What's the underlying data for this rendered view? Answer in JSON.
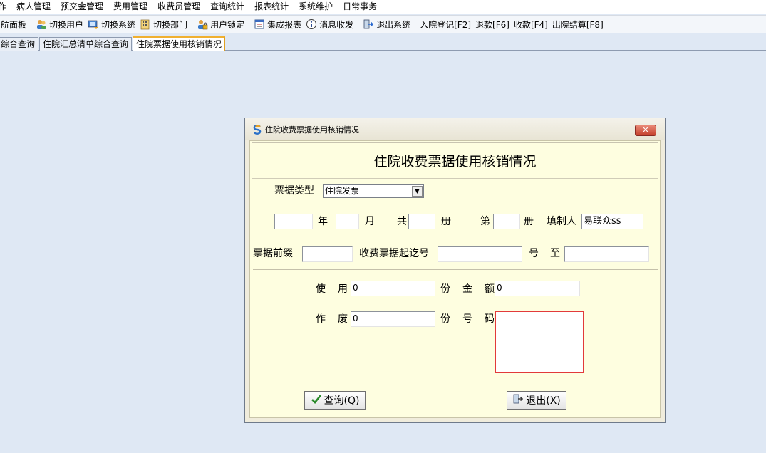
{
  "menubar": {
    "items": [
      "作",
      "病人管理",
      "预交金管理",
      "费用管理",
      "收费员管理",
      "查询统计",
      "报表统计",
      "系统维护",
      "日常事务"
    ]
  },
  "toolbar": {
    "buttons": [
      {
        "label": "航面板",
        "icon": "none"
      },
      {
        "label": "切换用户",
        "icon": "users-icon"
      },
      {
        "label": "切换系统",
        "icon": "switch-system-icon"
      },
      {
        "label": "切换部门",
        "icon": "department-icon"
      },
      {
        "label": "用户锁定",
        "icon": "lock-user-icon"
      },
      {
        "label": "集成报表",
        "icon": "report-icon"
      },
      {
        "label": "消息收发",
        "icon": "info-icon"
      },
      {
        "label": "退出系统",
        "icon": "exit-icon"
      },
      {
        "label": "入院登记[F2]",
        "icon": "none"
      },
      {
        "label": "退款[F6]",
        "icon": "none"
      },
      {
        "label": "收款[F4]",
        "icon": "none"
      },
      {
        "label": "出院结算[F8]",
        "icon": "none"
      }
    ]
  },
  "tabs": [
    "综合查询",
    "住院汇总清单综合查询",
    "住院票据使用核销情况"
  ],
  "dialog": {
    "window_title": "住院收费票据使用核销情况",
    "close_label": "✕",
    "heading": "住院收费票据使用核销情况",
    "ticket_type": {
      "label": "票据类型",
      "value": "住院发票"
    },
    "row2": {
      "year_value": "",
      "year_label": "年",
      "month_value": "",
      "month_label": "月",
      "total_label": "共",
      "total_value": "",
      "volume_label1": "册",
      "nth_label": "第",
      "nth_value": "",
      "volume_label2": "册",
      "maker_label": "填制人",
      "maker_value": "易联众ss"
    },
    "row3": {
      "prefix_label": "票据前缀",
      "prefix_value": "",
      "start_no_label": "收费票据起讫号",
      "start_no_value": "",
      "hao_label": "号",
      "to_label": "至",
      "end_no_value": ""
    },
    "used": {
      "label1": "使",
      "label2": "用",
      "value": "0",
      "unit": "份",
      "amount_label1": "金",
      "amount_label2": "额",
      "amount_value": "0"
    },
    "void": {
      "label1": "作",
      "label2": "废",
      "value": "0",
      "unit": "份",
      "numbers_label1": "号",
      "numbers_label2": "码",
      "numbers_value": ""
    },
    "buttons": {
      "query": "查询(Q)",
      "exit": "退出(X)"
    }
  },
  "colors": {
    "desktop_bg": "#dfe8f4",
    "dialog_body_bg": "#fefee0",
    "highlight_border": "#e23a3a",
    "active_tab_border": "#f0b030"
  }
}
